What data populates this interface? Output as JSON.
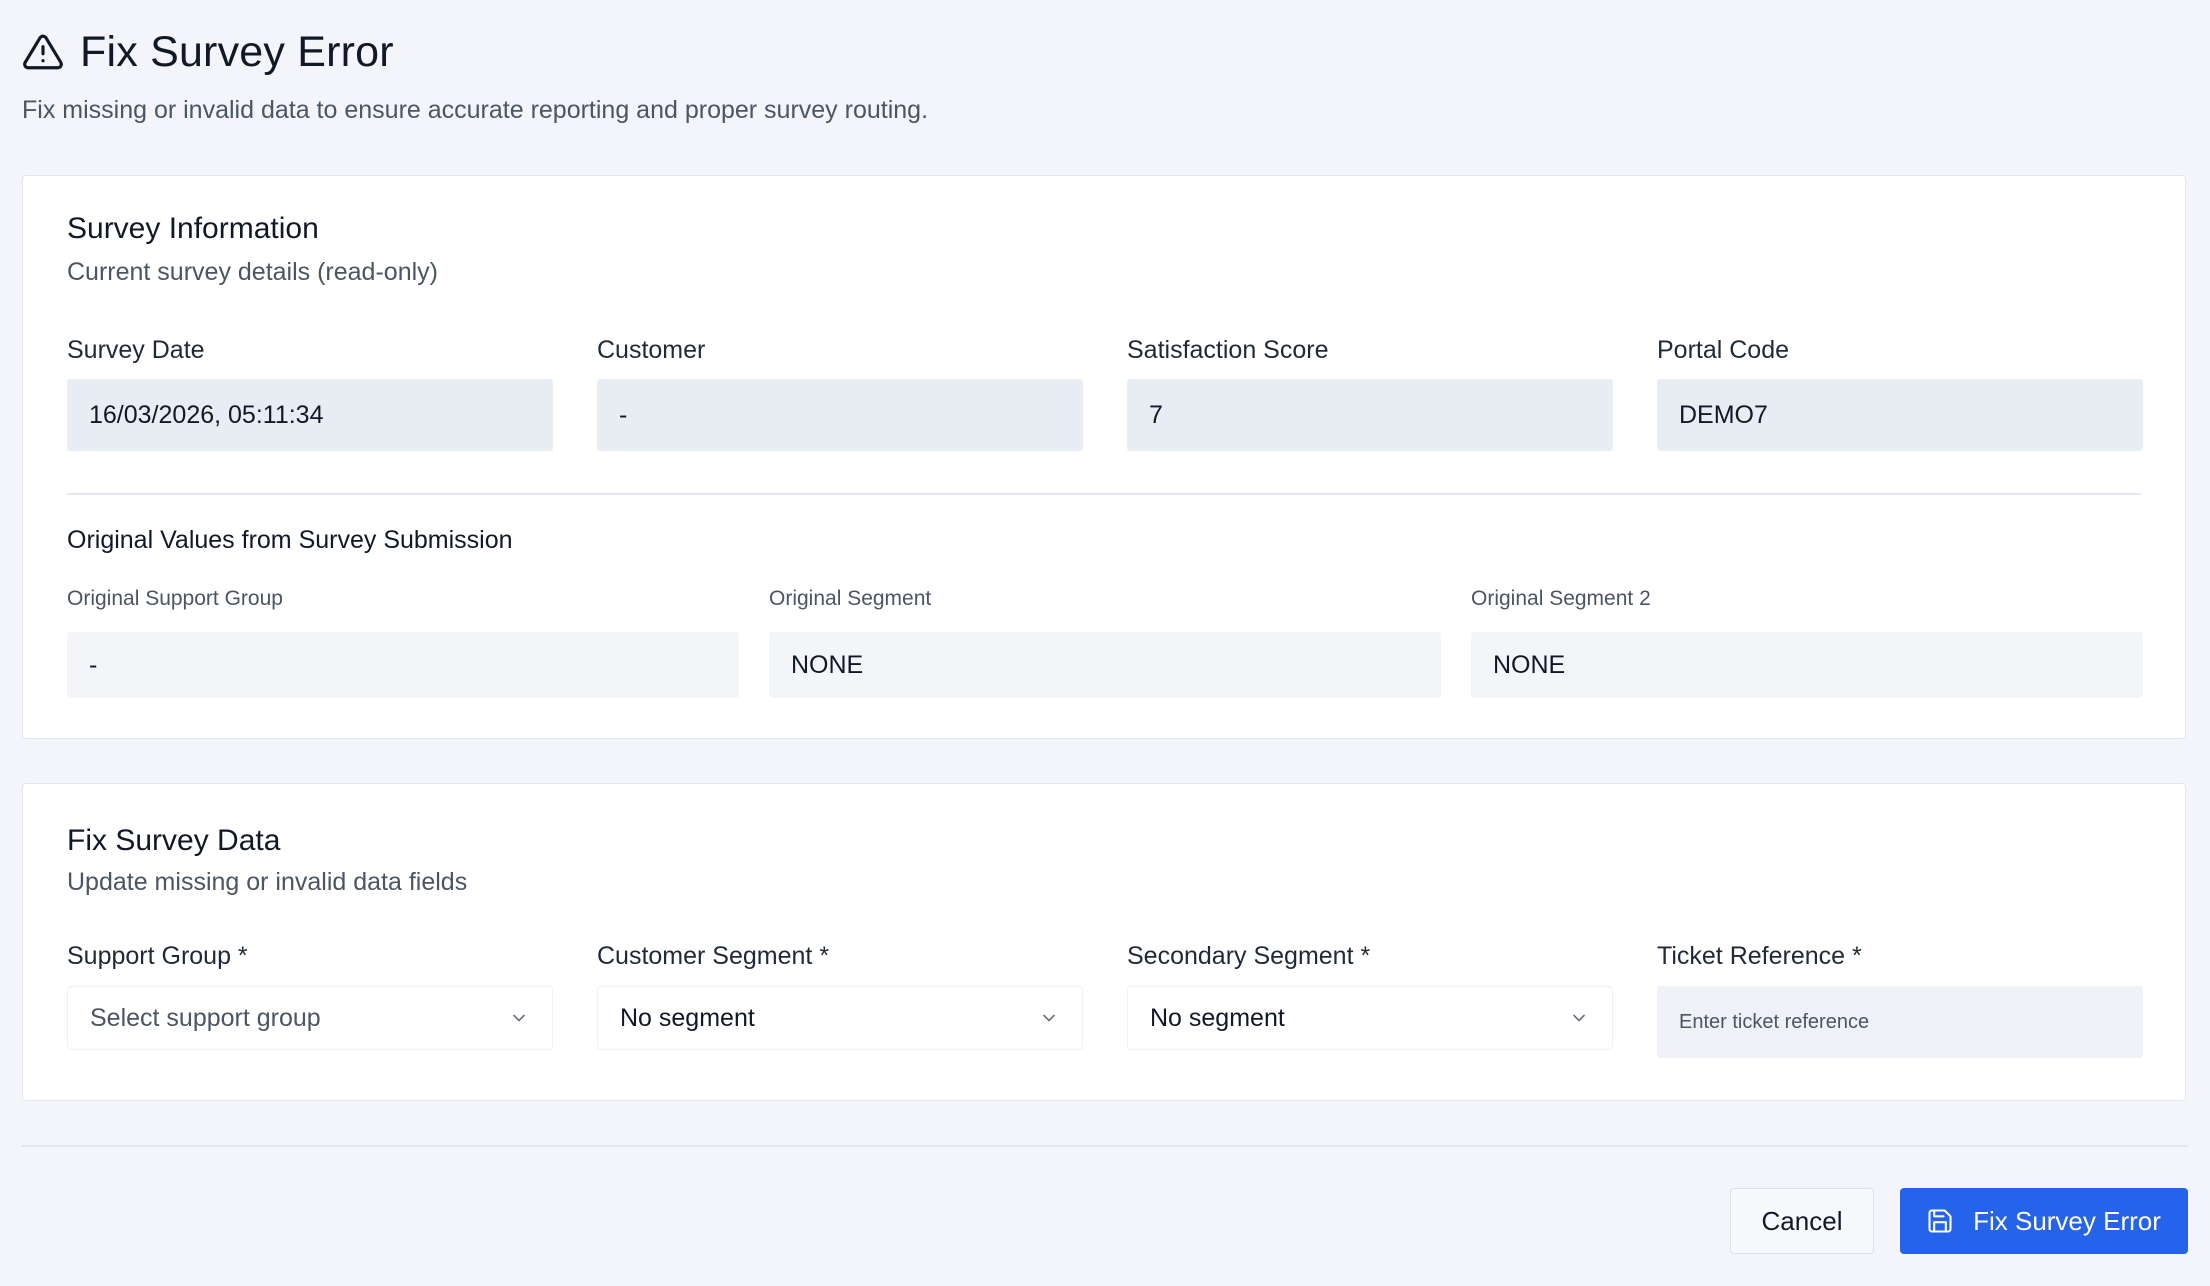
{
  "header": {
    "title": "Fix Survey Error",
    "subtitle": "Fix missing or invalid data to ensure accurate reporting and proper survey routing.",
    "icon": "warning-triangle-icon"
  },
  "survey_info": {
    "title": "Survey Information",
    "description": "Current survey details (read-only)",
    "fields": [
      {
        "label": "Survey Date",
        "value": "16/03/2026, 05:11:34"
      },
      {
        "label": "Customer",
        "value": "-"
      },
      {
        "label": "Satisfaction Score",
        "value": "7"
      },
      {
        "label": "Portal Code",
        "value": "DEMO7"
      }
    ],
    "original": {
      "title": "Original Values from Survey Submission",
      "fields": [
        {
          "label": "Original Support Group",
          "value": "-"
        },
        {
          "label": "Original Segment",
          "value": "NONE"
        },
        {
          "label": "Original Segment 2",
          "value": "NONE"
        }
      ]
    }
  },
  "fix_data": {
    "title": "Fix Survey Data",
    "description": "Update missing or invalid data fields",
    "support_group": {
      "label": "Support Group *",
      "placeholder": "Select support group"
    },
    "customer_segment": {
      "label": "Customer Segment *",
      "value": "No segment"
    },
    "secondary_segment": {
      "label": "Secondary Segment *",
      "value": "No segment"
    },
    "ticket_reference": {
      "label": "Ticket Reference *",
      "placeholder": "Enter ticket reference",
      "value": ""
    }
  },
  "actions": {
    "cancel_label": "Cancel",
    "submit_label": "Fix Survey Error",
    "submit_icon": "save-icon"
  },
  "colors": {
    "background": "#f3f5fa",
    "primary": "#2563eb",
    "readonly_field": "#e8edf4"
  }
}
